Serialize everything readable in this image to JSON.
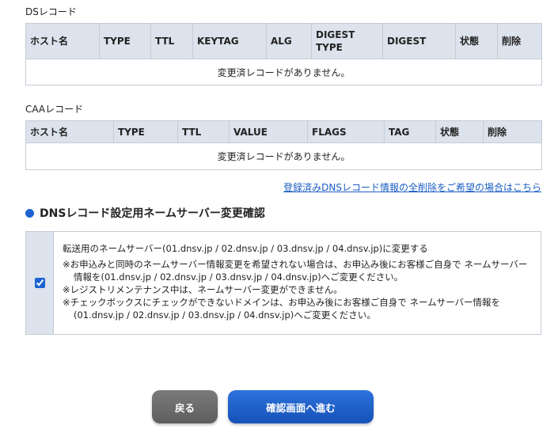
{
  "ds_section": {
    "label": "DSレコード",
    "columns": [
      "ホスト名",
      "TYPE",
      "TTL",
      "KEYTAG",
      "ALG",
      "DIGEST TYPE",
      "DIGEST",
      "状態",
      "削除"
    ],
    "empty_message": "変更済レコードがありません。"
  },
  "caa_section": {
    "label": "CAAレコード",
    "columns": [
      "ホスト名",
      "TYPE",
      "TTL",
      "VALUE",
      "FLAGS",
      "TAG",
      "状態",
      "削除"
    ],
    "empty_message": "変更済レコードがありません。"
  },
  "delete_all_link": "登録済みDNSレコード情報の全削除をご希望の場合はこちら",
  "nameserver": {
    "heading": "DNSレコード設定用ネームサーバー変更確認",
    "checked": true,
    "main_text": "転送用のネームサーバー(01.dnsv.jp / 02.dnsv.jp / 03.dnsv.jp / 04.dnsv.jp)に変更する",
    "notes": [
      "※お申込みと同時のネームサーバー情報変更を希望されない場合は、お申込み後にお客様ご自身で ネームサーバー情報を(01.dnsv.jp / 02.dnsv.jp / 03.dnsv.jp / 04.dnsv.jp)へご変更ください。",
      "※レジストリメンテナンス中は、ネームサーバー変更ができません。",
      "※チェックボックスにチェックができないドメインは、お申込み後にお客様ご自身で ネームサーバー情報を(01.dnsv.jp / 02.dnsv.jp / 03.dnsv.jp / 04.dnsv.jp)へご変更ください。"
    ]
  },
  "buttons": {
    "back": "戻る",
    "next": "確認画面へ進む"
  },
  "colors": {
    "accent": "#1e63d2",
    "header_bg": "#dce3ec",
    "link": "#1a5ec4"
  }
}
